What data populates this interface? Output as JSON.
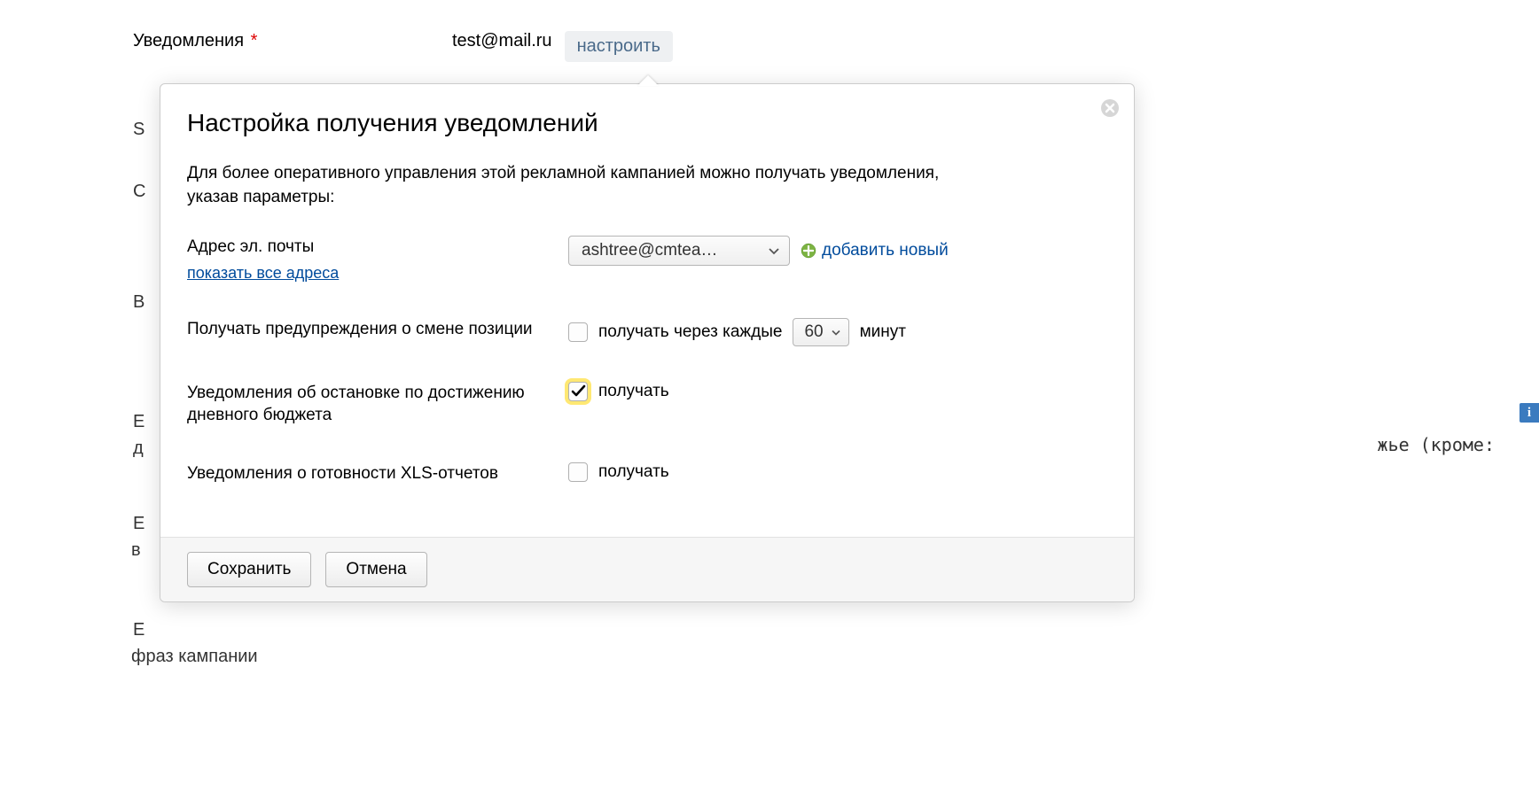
{
  "background": {
    "notifications_label": "Уведомления",
    "required_mark": "*",
    "email_value": "test@mail.ru",
    "configure_button": "настроить",
    "letters": {
      "l1": "S",
      "l2": "С",
      "l3": "В",
      "l4": "Е",
      "l5": "д",
      "l6": "Е",
      "l7": "в",
      "l8": "Е"
    },
    "fragment_right": "жье (кроме:",
    "phrases_line": "фраз кампании"
  },
  "dialog": {
    "title": "Настройка получения уведомлений",
    "description": "Для более оперативного управления этой рекламной кампанией можно получать уведомления, указав параметры:",
    "email": {
      "label": "Адрес эл. почты",
      "show_all": "показать все адреса",
      "selected": "ashtree@cmtea…",
      "add_new": "добавить новый"
    },
    "position_warnings": {
      "label": "Получать предупреждения о смене позиции",
      "checkbox_label": "получать через каждые",
      "interval_value": "60",
      "interval_unit": "минут",
      "checked": false
    },
    "budget_stop": {
      "label": "Уведомления об остановке по достижению дневного бюджета",
      "checkbox_label": "получать",
      "checked": true
    },
    "xls_reports": {
      "label": "Уведомления о готовности XLS-отчетов",
      "checkbox_label": "получать",
      "checked": false
    },
    "footer": {
      "save": "Сохранить",
      "cancel": "Отмена"
    }
  },
  "info_badge": "i"
}
